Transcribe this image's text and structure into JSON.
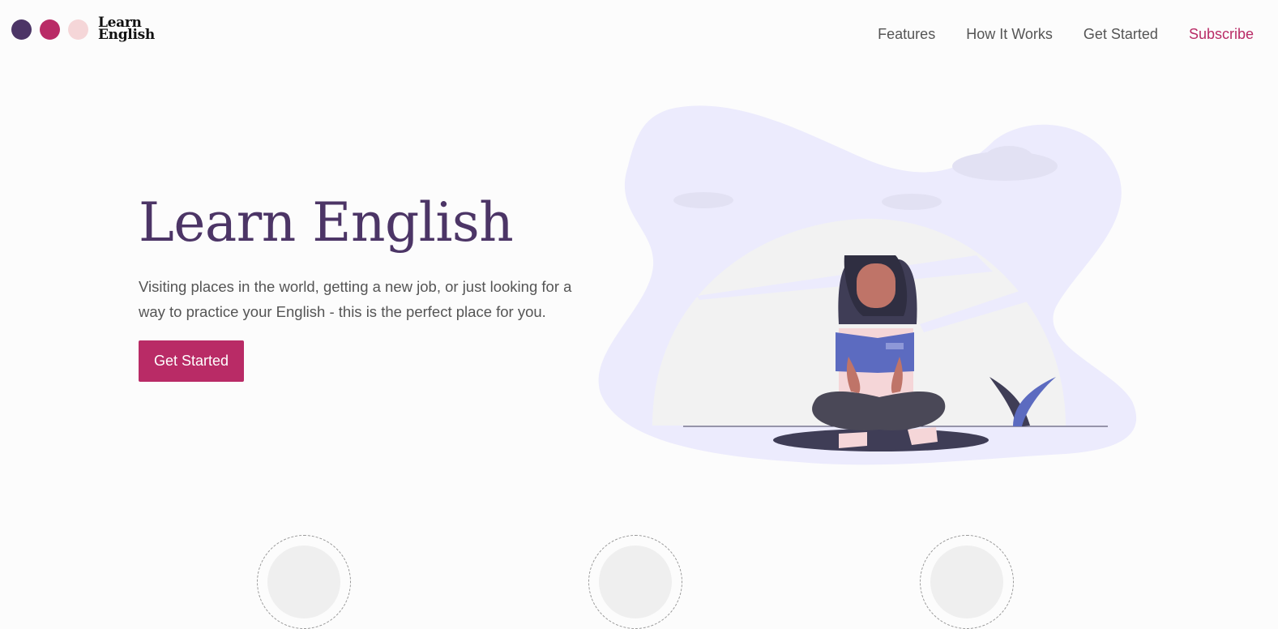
{
  "logo": {
    "line1": "Learn",
    "line2": "English"
  },
  "nav": {
    "features": "Features",
    "how_it_works": "How It Works",
    "get_started": "Get Started",
    "subscribe": "Subscribe"
  },
  "hero": {
    "title": "Learn English",
    "subtitle": "Visiting places in the world, getting a new job, or just looking for a way to practice your English - this is the perfect place for you.",
    "cta": "Get Started"
  },
  "colors": {
    "primary": "#4c3566",
    "accent": "#b92b66",
    "light": "#f5d6d8",
    "blob": "#ecebfd",
    "book": "#5c6bc0"
  },
  "icons": [
    "feature-chat-icon",
    "feature-book-icon",
    "feature-clipboard-icon"
  ]
}
